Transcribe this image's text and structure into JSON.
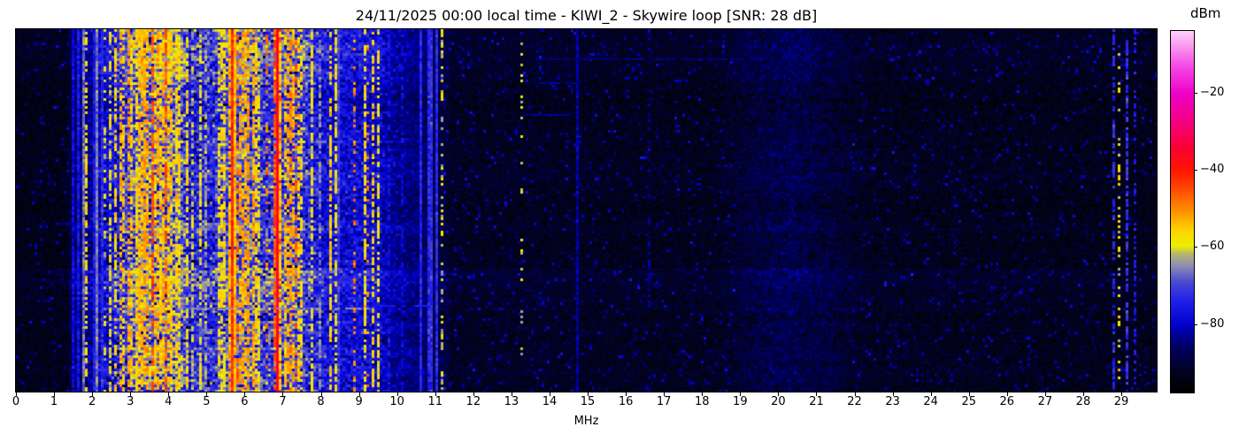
{
  "title": "24/11/2025 00:00 local time - KIWI_2 - Skywire loop [SNR: 28 dB]",
  "colorbar": {
    "label": "dBm",
    "vmin": -97.5,
    "vmax": -3.7,
    "ticks": [
      {
        "value": -20,
        "label": "−20"
      },
      {
        "value": -40,
        "label": "−40"
      },
      {
        "value": -60,
        "label": "−60"
      },
      {
        "value": -80,
        "label": "−80"
      }
    ],
    "stops": [
      [
        0.0,
        "#000000"
      ],
      [
        0.05,
        "#02021a"
      ],
      [
        0.13,
        "#000066"
      ],
      [
        0.186,
        "#0000c8"
      ],
      [
        0.25,
        "#1e1eea"
      ],
      [
        0.305,
        "#4848d0"
      ],
      [
        0.35,
        "#8c8cb4"
      ],
      [
        0.383,
        "#b4b46e"
      ],
      [
        0.405,
        "#eeee00"
      ],
      [
        0.45,
        "#ffd200"
      ],
      [
        0.505,
        "#ff8c00"
      ],
      [
        0.565,
        "#ff4600"
      ],
      [
        0.615,
        "#ff1400"
      ],
      [
        0.68,
        "#fa0037"
      ],
      [
        0.75,
        "#f50082"
      ],
      [
        0.826,
        "#ee00c8"
      ],
      [
        0.9,
        "#f546e6"
      ],
      [
        0.96,
        "#fa9bef"
      ],
      [
        1.0,
        "#ffd2fa"
      ]
    ]
  },
  "chart_data": {
    "type": "heatmap",
    "xlabel": "MHz",
    "x_range": [
      0,
      29.93
    ],
    "x_ticks": [
      0,
      1,
      2,
      3,
      4,
      5,
      6,
      7,
      8,
      9,
      10,
      11,
      12,
      13,
      14,
      15,
      16,
      17,
      18,
      19,
      20,
      21,
      22,
      23,
      24,
      25,
      26,
      27,
      28,
      29
    ],
    "y_axis": "time (24h waterfall, no tick labels shown)",
    "value_unit": "dBm",
    "noise_floor_dbm": -93,
    "profile": [
      [
        0.0,
        -93,
        2.4
      ],
      [
        1.35,
        -93,
        2.4
      ],
      [
        1.5,
        -85,
        5
      ],
      [
        1.95,
        -83,
        6
      ],
      [
        2.55,
        -76,
        8.5
      ],
      [
        2.9,
        -71,
        9.5
      ],
      [
        3.25,
        -65,
        10
      ],
      [
        4.3,
        -65,
        10
      ],
      [
        4.55,
        -74,
        8.5
      ],
      [
        5.2,
        -72,
        8.5
      ],
      [
        5.45,
        -68,
        9
      ],
      [
        6.3,
        -68,
        9
      ],
      [
        6.55,
        -71,
        9
      ],
      [
        7.0,
        -69,
        9
      ],
      [
        7.6,
        -71,
        8.5
      ],
      [
        8.0,
        -76,
        7.5
      ],
      [
        8.6,
        -78,
        6.5
      ],
      [
        9.1,
        -77,
        7
      ],
      [
        9.55,
        -79,
        6
      ],
      [
        9.75,
        -82,
        5
      ],
      [
        10.6,
        -85,
        4.2
      ],
      [
        11.2,
        -89,
        3.4
      ],
      [
        11.45,
        -92,
        2.8
      ],
      [
        13.0,
        -92,
        2.8
      ],
      [
        16.0,
        -92.5,
        2.7
      ],
      [
        18.4,
        -92.5,
        2.8
      ],
      [
        19.3,
        -89.5,
        4.2
      ],
      [
        20.3,
        -88,
        4.6
      ],
      [
        21.4,
        -90,
        4.0
      ],
      [
        22.4,
        -92.5,
        3.0
      ],
      [
        29.93,
        -93,
        2.5
      ]
    ],
    "lines": [
      {
        "f": 1.49,
        "level": -78,
        "style": "solid"
      },
      {
        "f": 1.66,
        "level": -76,
        "style": "solid"
      },
      {
        "f": 1.75,
        "level": -67,
        "style": "solid"
      },
      {
        "f": 2.02,
        "level": -75,
        "style": "solid"
      },
      {
        "f": 2.14,
        "level": -66,
        "style": "solid"
      },
      {
        "f": 2.26,
        "level": -73,
        "style": "solid"
      },
      {
        "f": 5.65,
        "level": -42,
        "style": "solid"
      },
      {
        "f": 6.85,
        "level": -35,
        "style": "solid"
      },
      {
        "f": 8.45,
        "level": -71,
        "style": "solid"
      },
      {
        "f": 10.65,
        "level": -74,
        "style": "solid"
      },
      {
        "f": 10.8,
        "level": -73,
        "style": "solid"
      },
      {
        "f": 10.93,
        "level": -72,
        "style": "solid"
      },
      {
        "f": 11.05,
        "level": -73,
        "style": "solid"
      },
      {
        "f": 14.7,
        "level": -82,
        "style": "solid"
      },
      {
        "f": 1.88,
        "level": -57,
        "style": "dashed"
      },
      {
        "f": 2.5,
        "level": -59,
        "style": "dashed"
      },
      {
        "f": 2.6,
        "level": -56,
        "style": "dashed"
      },
      {
        "f": 2.72,
        "level": -53,
        "style": "dashed"
      },
      {
        "f": 2.84,
        "level": -55,
        "style": "dashed"
      },
      {
        "f": 2.95,
        "level": -51,
        "style": "dashed"
      },
      {
        "f": 3.05,
        "level": -55,
        "style": "dashed"
      },
      {
        "f": 3.17,
        "level": -56,
        "style": "dashed"
      },
      {
        "f": 3.25,
        "level": -54,
        "style": "dashed"
      },
      {
        "f": 3.33,
        "level": -53,
        "style": "dashed"
      },
      {
        "f": 3.4,
        "level": -52,
        "style": "dashed"
      },
      {
        "f": 3.48,
        "level": -52,
        "style": "dashed"
      },
      {
        "f": 3.56,
        "level": -44,
        "style": "dashed"
      },
      {
        "f": 3.63,
        "level": -54,
        "style": "dashed"
      },
      {
        "f": 3.7,
        "level": -52,
        "style": "dashed"
      },
      {
        "f": 3.82,
        "level": -55,
        "style": "dashed"
      },
      {
        "f": 3.88,
        "level": -53,
        "style": "dashed"
      },
      {
        "f": 3.95,
        "level": -46,
        "style": "dashed"
      },
      {
        "f": 4.03,
        "level": -55,
        "style": "dashed"
      },
      {
        "f": 4.1,
        "level": -54,
        "style": "dashed"
      },
      {
        "f": 4.18,
        "level": -56,
        "style": "dashed"
      },
      {
        "f": 4.25,
        "level": -57,
        "style": "dashed"
      },
      {
        "f": 4.47,
        "level": -57,
        "style": "dashed"
      },
      {
        "f": 4.62,
        "level": -61,
        "style": "dashed"
      },
      {
        "f": 4.85,
        "level": -59,
        "style": "dashed"
      },
      {
        "f": 5.0,
        "level": -63,
        "style": "dashed"
      },
      {
        "f": 5.3,
        "level": -58,
        "style": "dashed"
      },
      {
        "f": 5.4,
        "level": -55,
        "style": "dashed"
      },
      {
        "f": 5.5,
        "level": -57,
        "style": "dashed"
      },
      {
        "f": 5.75,
        "level": -54,
        "style": "dashed"
      },
      {
        "f": 5.88,
        "level": -52,
        "style": "dashed"
      },
      {
        "f": 5.95,
        "level": -51,
        "style": "dashed"
      },
      {
        "f": 6.05,
        "level": -53,
        "style": "dashed"
      },
      {
        "f": 6.12,
        "level": -51,
        "style": "dashed"
      },
      {
        "f": 6.2,
        "level": -52,
        "style": "dashed"
      },
      {
        "f": 6.28,
        "level": -56,
        "style": "dashed"
      },
      {
        "f": 6.4,
        "level": -58,
        "style": "dashed"
      },
      {
        "f": 6.95,
        "level": -56,
        "style": "dashed"
      },
      {
        "f": 7.05,
        "level": -54,
        "style": "dashed"
      },
      {
        "f": 7.13,
        "level": -52,
        "style": "dashed"
      },
      {
        "f": 7.2,
        "level": -50,
        "style": "dashed"
      },
      {
        "f": 7.28,
        "level": -53,
        "style": "dashed"
      },
      {
        "f": 7.42,
        "level": -55,
        "style": "dashed"
      },
      {
        "f": 7.5,
        "level": -57,
        "style": "dashed"
      },
      {
        "f": 7.8,
        "level": -59,
        "style": "dashed"
      },
      {
        "f": 8.0,
        "level": -65,
        "style": "dashed"
      },
      {
        "f": 8.27,
        "level": -55,
        "style": "dashed"
      },
      {
        "f": 8.37,
        "level": -58,
        "style": "dashed"
      },
      {
        "f": 9.15,
        "level": -57,
        "style": "dashed"
      },
      {
        "f": 9.25,
        "level": -56,
        "style": "dashed"
      },
      {
        "f": 9.38,
        "level": -55,
        "style": "dashed"
      },
      {
        "f": 9.48,
        "level": -58,
        "style": "dashed"
      },
      {
        "f": 9.8,
        "level": -77,
        "style": "dashed"
      },
      {
        "f": 10.1,
        "level": -79,
        "style": "dashed"
      },
      {
        "f": 28.8,
        "level": -73,
        "style": "dashed"
      },
      {
        "f": 29.13,
        "level": -72,
        "style": "dashed"
      },
      {
        "f": 29.35,
        "level": -75,
        "style": "dotted"
      },
      {
        "f": 2.35,
        "level": -60,
        "style": "dotted"
      },
      {
        "f": 5.85,
        "level": -47,
        "style": "dotted"
      },
      {
        "f": 6.55,
        "level": -48,
        "style": "dotted"
      },
      {
        "f": 7.35,
        "level": -47,
        "style": "dotted"
      },
      {
        "f": 8.85,
        "level": -49,
        "style": "dotted"
      },
      {
        "f": 11.15,
        "level": -61,
        "style": "dotted"
      },
      {
        "f": 16.6,
        "level": -83,
        "style": "dotted"
      },
      {
        "f": 28.95,
        "level": -59,
        "style": "dotted"
      },
      {
        "f": 9.2,
        "level": -48,
        "style": "sparse"
      },
      {
        "f": 13.26,
        "level": -61,
        "style": "sparse"
      }
    ],
    "hlines": [
      {
        "y": 0.08,
        "f1": 13.5,
        "f2": 19.5,
        "level": -84,
        "p": 0.85
      },
      {
        "y": 0.146,
        "f1": 13.6,
        "f2": 14.8,
        "level": -83,
        "p": 0.8
      },
      {
        "y": 0.232,
        "f1": 13.2,
        "f2": 14.5,
        "level": -83,
        "p": 0.8
      },
      {
        "y": 0.53,
        "f1": 0.95,
        "f2": 1.4,
        "level": -82,
        "p": 0.8
      },
      {
        "y": 0.76,
        "f1": 9.3,
        "f2": 10.7,
        "level": -75,
        "p": 0.65
      },
      {
        "y": 0.765,
        "f1": 4.4,
        "f2": 9.3,
        "level": -66,
        "p": 0.6
      }
    ]
  }
}
